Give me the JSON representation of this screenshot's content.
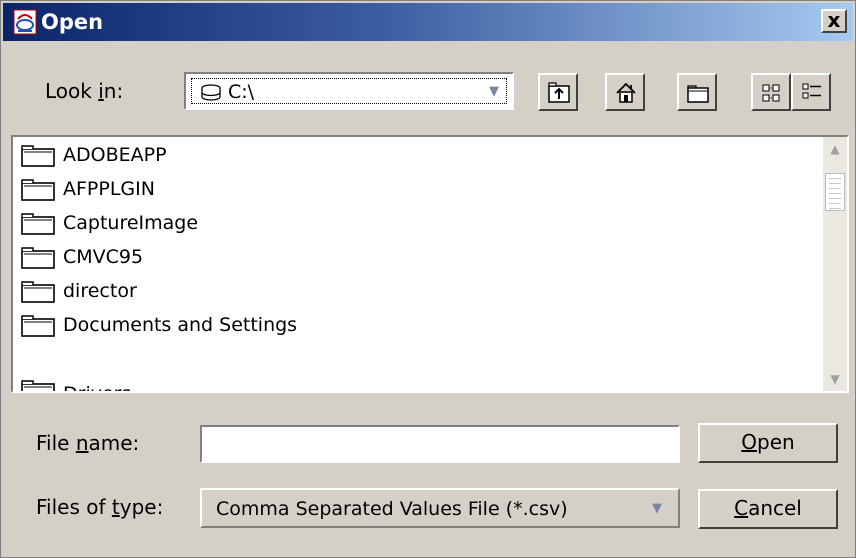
{
  "window": {
    "title": "Open",
    "close_label": "x"
  },
  "look_in": {
    "prefix": "Look ",
    "accel": "i",
    "suffix": "n:",
    "value": "C:\\"
  },
  "toolbar": {
    "up_icon": "up-one-level-icon",
    "home_icon": "home-icon",
    "new_folder_icon": "new-folder-icon",
    "list_view_icon": "list-view-icon",
    "details_view_icon": "details-view-icon"
  },
  "files": [
    {
      "name": "ADOBEAPP"
    },
    {
      "name": "AFPPLGIN"
    },
    {
      "name": "CaptureImage"
    },
    {
      "name": "CMVC95"
    },
    {
      "name": "director"
    },
    {
      "name": "Documents and Settings"
    },
    {
      "name": "Drivers"
    }
  ],
  "file_name": {
    "prefix": "File ",
    "accel": "n",
    "suffix": "ame:",
    "value": ""
  },
  "file_type": {
    "prefix": "Files of ",
    "accel": "t",
    "suffix": "ype:",
    "value": "Comma Separated Values File (*.csv)"
  },
  "buttons": {
    "open": {
      "accel": "O",
      "rest": "pen"
    },
    "cancel": {
      "accel": "C",
      "rest": "ancel"
    }
  },
  "colors": {
    "title_start": "#0a246a",
    "title_end": "#a6caf0",
    "dialog_bg": "#d4d0c8"
  }
}
